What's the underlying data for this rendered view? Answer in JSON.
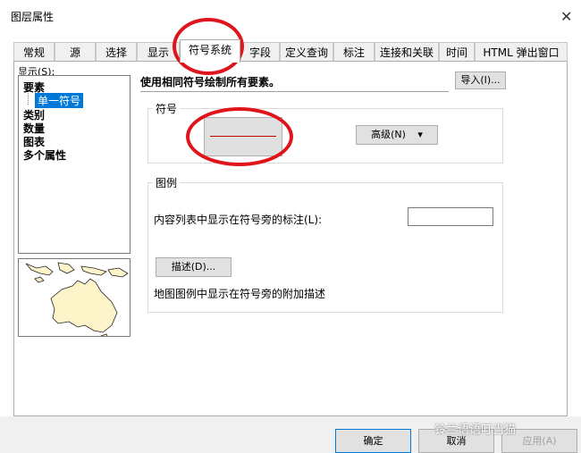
{
  "window": {
    "title": "图层属性",
    "close_glyph": "✕"
  },
  "tabs": [
    {
      "label": "常规"
    },
    {
      "label": "源"
    },
    {
      "label": "选择"
    },
    {
      "label": "显示"
    },
    {
      "label": "符号系统"
    },
    {
      "label": "字段"
    },
    {
      "label": "定义查询"
    },
    {
      "label": "标注"
    },
    {
      "label": "连接和关联"
    },
    {
      "label": "时间"
    },
    {
      "label": "HTML 弹出窗口"
    }
  ],
  "active_tab": "符号系统",
  "show_list": {
    "label": "显示(S):",
    "items": [
      {
        "label": "要素"
      },
      {
        "label": "单一符号",
        "selected": true
      },
      {
        "label": "类别"
      },
      {
        "label": "数量"
      },
      {
        "label": "图表"
      },
      {
        "label": "多个属性"
      }
    ]
  },
  "main": {
    "description": "使用相同符号绘制所有要素。",
    "import_button": "导入(I)...",
    "symbol_group": {
      "title": "符号",
      "advanced_button": "高级(N)",
      "advanced_arrow": "▾",
      "line_color": "#c00000"
    },
    "legend_group": {
      "title": "图例",
      "label_prompt": "内容列表中显示在符号旁的标注(L):",
      "label_value": "",
      "describe_button": "描述(D)...",
      "describe_prompt": "地图图例中显示在符号旁的附加描述"
    }
  },
  "footer": {
    "ok": "确定",
    "cancel": "取消",
    "apply": "应用(A)"
  },
  "watermark": "铃兰语语叮当猫",
  "annotation_color": "#e0141b"
}
